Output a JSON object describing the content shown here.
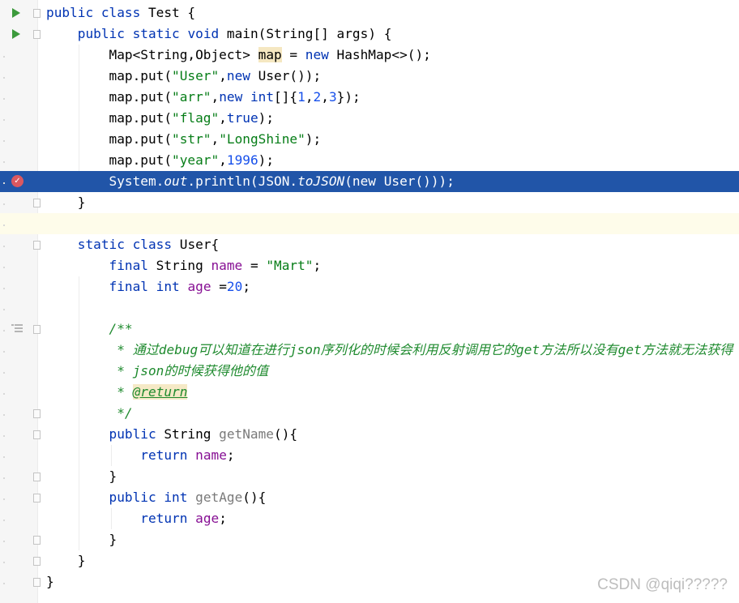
{
  "editor": {
    "line_height": 26,
    "lines": [
      "public class Test {",
      "    public static void main(String[] args) {",
      "        Map<String,Object> map = new HashMap<>();",
      "        map.put(\"User\",new User());",
      "        map.put(\"arr\",new int[]{1,2,3});",
      "        map.put(\"flag\",true);",
      "        map.put(\"str\",\"LongShine\");",
      "        map.put(\"year\",1996);",
      "        System.out.println(JSON.toJSON(new User()));",
      "    }",
      "",
      "    static class User{",
      "        final String name = \"Mart\";",
      "        final int age =20;",
      "",
      "        /**",
      "         * 通过debug可以知道在进行json序列化的时候会利用反射调用它的get方法所以没有get方法就无法获得",
      "         * json的时候获得他的值",
      "         * @return",
      "         */",
      "        public String getName(){",
      "            return name;",
      "        }",
      "        public int getAge(){",
      "            return age;",
      "        }",
      "    }",
      "}"
    ],
    "highlighted_line": 9,
    "caret_line": 11,
    "run_gutter_lines": [
      1,
      2
    ],
    "breakpoint_line": 9,
    "doc_icon_line": 16,
    "colors": {
      "keyword": "#0033b3",
      "string": "#067d17",
      "number": "#1750eb",
      "field": "#871094",
      "doc_comment": "#1e8a2e",
      "selection": "#2155a8"
    }
  },
  "watermark": "CSDN @qiqi?????"
}
